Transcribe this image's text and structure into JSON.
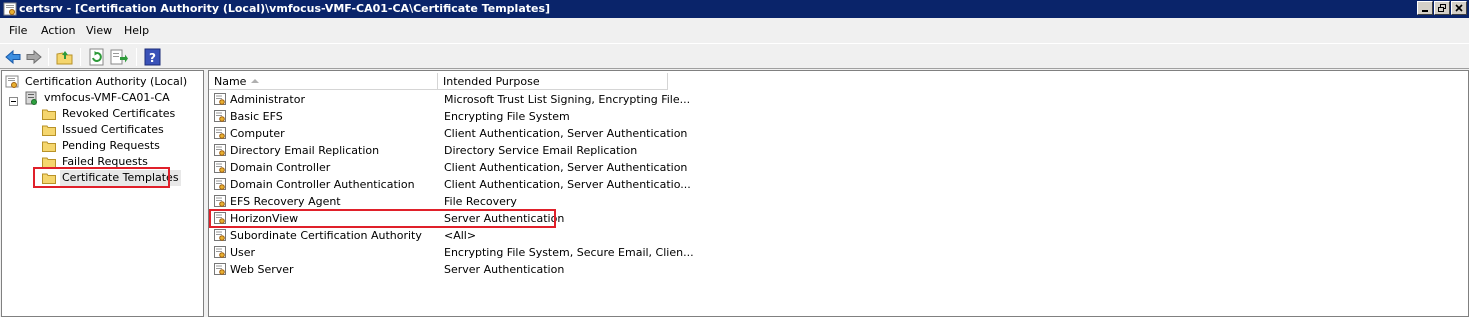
{
  "window": {
    "title": "certsrv - [Certification Authority (Local)\\vmfocus-VMF-CA01-CA\\Certificate Templates]"
  },
  "menu": [
    "File",
    "Action",
    "View",
    "Help"
  ],
  "toolbar": {
    "icons": [
      "back-arrow-icon",
      "forward-arrow-icon",
      "up-folder-icon",
      "refresh-icon",
      "export-list-icon",
      "help-icon"
    ]
  },
  "tree": {
    "root": "Certification Authority (Local)",
    "ca": "vmfocus-VMF-CA01-CA",
    "folders": [
      "Revoked Certificates",
      "Issued Certificates",
      "Pending Requests",
      "Failed Requests",
      "Certificate Templates"
    ],
    "selected": "Certificate Templates"
  },
  "list": {
    "columns": [
      "Name",
      "Intended Purpose"
    ],
    "rows": [
      {
        "name": "Administrator",
        "purpose": "Microsoft Trust List Signing, Encrypting File..."
      },
      {
        "name": "Basic EFS",
        "purpose": "Encrypting File System"
      },
      {
        "name": "Computer",
        "purpose": "Client Authentication, Server Authentication"
      },
      {
        "name": "Directory Email Replication",
        "purpose": "Directory Service Email Replication"
      },
      {
        "name": "Domain Controller",
        "purpose": "Client Authentication, Server Authentication"
      },
      {
        "name": "Domain Controller Authentication",
        "purpose": "Client Authentication, Server Authenticatio..."
      },
      {
        "name": "EFS Recovery Agent",
        "purpose": "File Recovery"
      },
      {
        "name": "HorizonView",
        "purpose": "Server Authentication"
      },
      {
        "name": "Subordinate Certification Authority",
        "purpose": "<All>"
      },
      {
        "name": "User",
        "purpose": "Encrypting File System, Secure Email, Clien..."
      },
      {
        "name": "Web Server",
        "purpose": "Server Authentication"
      }
    ],
    "highlighted_row": "HorizonView"
  },
  "colors": {
    "titlebar": "#0a246a",
    "highlight_box": "#e0202a",
    "folder": "#f5d66e"
  }
}
